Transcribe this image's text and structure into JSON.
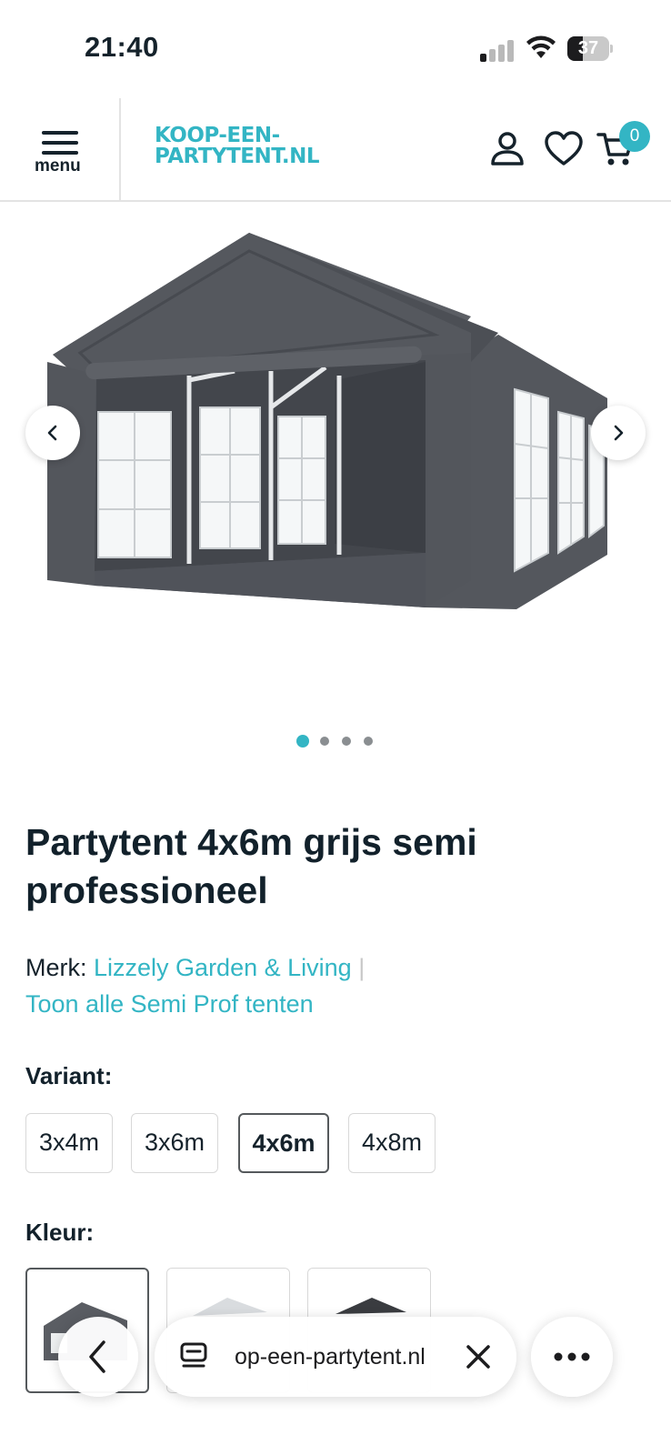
{
  "status_bar": {
    "time": "21:40",
    "battery": "37",
    "battery_level": 0.37
  },
  "header": {
    "menu_label": "menu",
    "logo_line1": "KOOP-EEN-",
    "logo_line2": "PARTYTENT.NL",
    "cart_count": "0",
    "icons": [
      "menu-icon",
      "user-icon",
      "heart-icon",
      "cart-icon"
    ]
  },
  "gallery": {
    "image_alt": "grey party tent",
    "slide_count": 4,
    "active_slide": 1,
    "prev_icon": "chevron-left-icon",
    "next_icon": "chevron-right-icon"
  },
  "product": {
    "title": "Partytent 4x6m grijs semi professioneel",
    "brand_label": "Merk:",
    "brand_name": "Lizzely Garden & Living",
    "brand_separator": "|",
    "all_link": "Toon alle Semi Prof tenten",
    "variant_label": "Variant:",
    "variants": [
      "3x4m",
      "3x6m",
      "4x6m",
      "4x8m"
    ],
    "selected_variant": "4x6m",
    "color_label": "Kleur:",
    "colors": [
      "grijs",
      "wit",
      "zwart/wit"
    ]
  },
  "browser_bar": {
    "url": "op-een-partytent.nl",
    "icons": [
      "back-icon",
      "tabs-icon",
      "close-icon",
      "more-icon"
    ]
  },
  "colors": {
    "accent": "#33b5c4",
    "text": "#12212b",
    "tent": "#4f5258"
  }
}
